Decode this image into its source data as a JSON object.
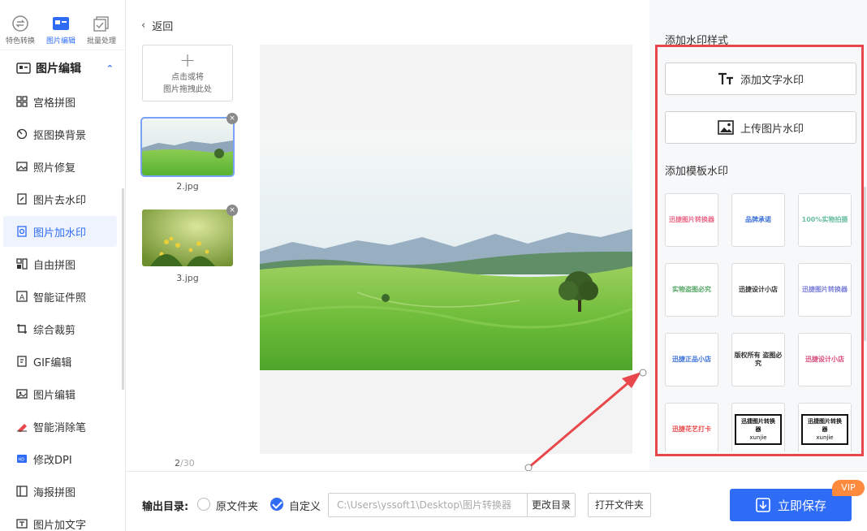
{
  "top_tabs": [
    {
      "label": "特色转换",
      "icon": "convert-icon"
    },
    {
      "label": "图片编辑",
      "icon": "image-edit-icon"
    },
    {
      "label": "批量处理",
      "icon": "batch-icon"
    }
  ],
  "sidebar": {
    "group_title": "图片编辑",
    "items": [
      {
        "label": "宫格拼图",
        "icon": "grid-icon"
      },
      {
        "label": "抠图换背景",
        "icon": "cutout-icon"
      },
      {
        "label": "照片修复",
        "icon": "photo-repair-icon"
      },
      {
        "label": "图片去水印",
        "icon": "remove-watermark-icon"
      },
      {
        "label": "图片加水印",
        "icon": "add-watermark-icon"
      },
      {
        "label": "自由拼图",
        "icon": "collage-icon"
      },
      {
        "label": "智能证件照",
        "icon": "id-photo-icon"
      },
      {
        "label": "综合裁剪",
        "icon": "crop-icon"
      },
      {
        "label": "GIF编辑",
        "icon": "gif-icon"
      },
      {
        "label": "图片编辑",
        "icon": "image-edit-icon"
      },
      {
        "label": "智能消除笔",
        "icon": "eraser-icon"
      },
      {
        "label": "修改DPI",
        "icon": "dpi-icon"
      },
      {
        "label": "海报拼图",
        "icon": "poster-icon"
      },
      {
        "label": "图片加文字",
        "icon": "add-text-icon"
      }
    ]
  },
  "center": {
    "back_label": "返回",
    "uploader_line1": "点击或将",
    "uploader_line2": "图片拖拽此处",
    "files": [
      "2.jpg",
      "3.jpg"
    ],
    "page_current": "2",
    "page_total": "/30"
  },
  "right_panel": {
    "style_title": "添加水印样式",
    "add_text_btn": "添加文字水印",
    "upload_img_btn": "上传图片水印",
    "template_title": "添加模板水印",
    "templates": [
      "迅捷图片转换器",
      "品牌承诺",
      "100%实物拍摄",
      "实物盗图必究",
      "迅捷设计小店",
      "迅捷图片转换器",
      "迅捷正品小店",
      "版权所有 盗图必究",
      "迅捷设计小店",
      "迅捷花艺打卡",
      "迅捷图片转换器",
      "迅捷图片转换器"
    ],
    "template_sub": "xunjie"
  },
  "bottom": {
    "output_label": "输出目录:",
    "opt_original": "原文件夹",
    "opt_custom": "自定义",
    "path_value": "C:\\Users\\yssoft1\\Desktop\\图片转换器",
    "change_dir_btn": "更改目录",
    "open_dir_btn": "打开文件夹",
    "save_btn": "立即保存",
    "vip_badge": "VIP"
  },
  "colors": {
    "accent": "#2f6cf6",
    "annotation": "#e8484b",
    "vip": "#ff8a3d"
  }
}
